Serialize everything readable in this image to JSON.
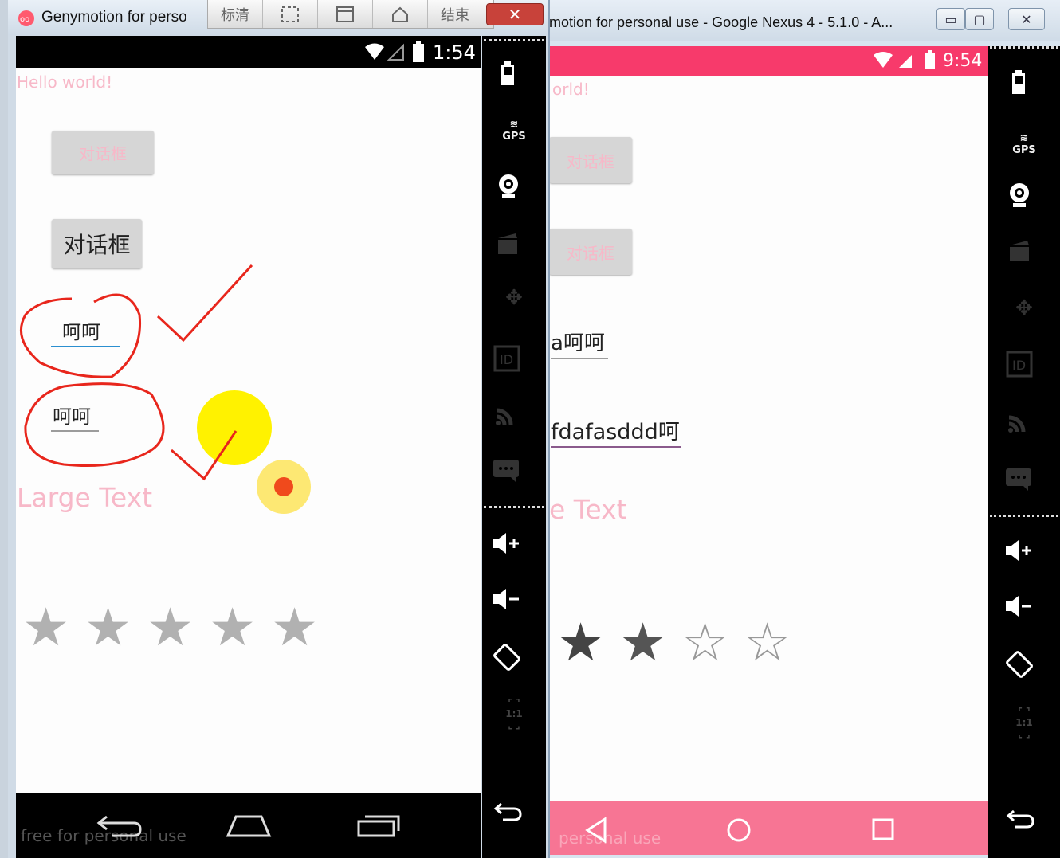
{
  "left_window": {
    "title": "Genymotion for perso",
    "toolbar": [
      "标清",
      "",
      "",
      "",
      "结束"
    ],
    "close_label": "✕",
    "status_time": "1:54",
    "app": {
      "hello": "Hello world!",
      "button_disabled": "对话框",
      "button_enabled": "对话框",
      "edit1": "呵呵",
      "edit2": "呵呵",
      "large_text": "Large Text",
      "rating_stars": 5,
      "rating_value": 0
    },
    "watermark": "free for personal use"
  },
  "right_window": {
    "title": "motion for personal use - Google Nexus 4 - 5.1.0 - A...",
    "status_time": "9:54",
    "app": {
      "hello": "orld!",
      "button1": "对话框",
      "button2": "对话框",
      "edit1": "a呵呵",
      "edit2": "fdafasddd呵",
      "large_text": "e Text",
      "rating_stars": 4,
      "rating_value": 1.5
    },
    "watermark": "personal use"
  },
  "sidebar_icons": [
    "battery-icon",
    "gps-icon",
    "camera-icon",
    "video-icon",
    "move-icon",
    "id-icon",
    "rss-icon",
    "sms-icon",
    "volume-up-icon",
    "volume-down-icon",
    "rotate-icon",
    "scale-icon",
    "back-icon"
  ],
  "colors": {
    "accent_pink": "#f73a6b",
    "nav_pink": "#f77594",
    "annotation_red": "#e8261c",
    "highlight_yellow": "#fff200"
  }
}
